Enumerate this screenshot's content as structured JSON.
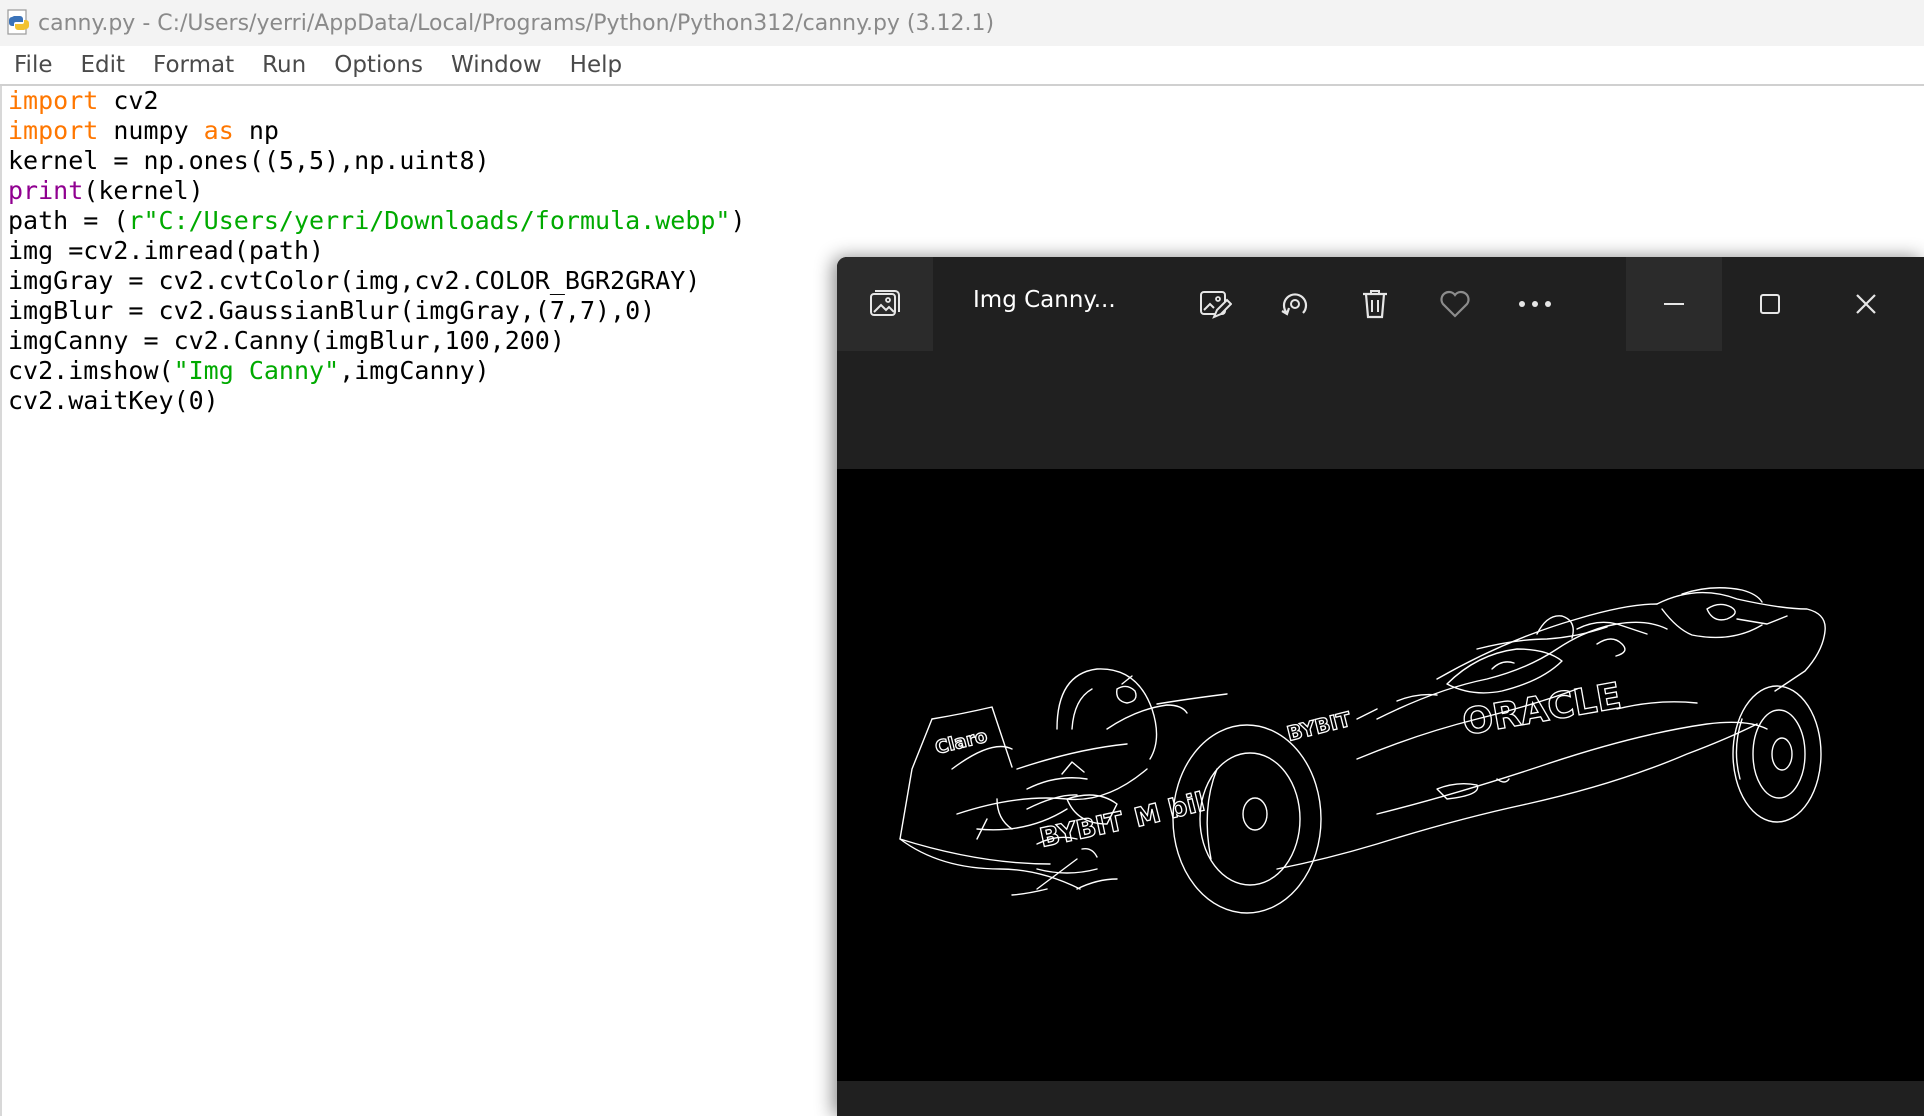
{
  "window": {
    "title": "canny.py - C:/Users/yerri/AppData/Local/Programs/Python/Python312/canny.py (3.12.1)"
  },
  "menu": {
    "items": [
      "File",
      "Edit",
      "Format",
      "Run",
      "Options",
      "Window",
      "Help"
    ]
  },
  "code": {
    "lines": [
      [
        {
          "t": "import",
          "c": "kw"
        },
        {
          "t": " cv2",
          "c": ""
        }
      ],
      [
        {
          "t": "import",
          "c": "kw"
        },
        {
          "t": " numpy ",
          "c": ""
        },
        {
          "t": "as",
          "c": "kw"
        },
        {
          "t": " np",
          "c": ""
        }
      ],
      [
        {
          "t": "kernel = np.ones((5,5),np.uint8)",
          "c": ""
        }
      ],
      [
        {
          "t": "print",
          "c": "bi"
        },
        {
          "t": "(kernel)",
          "c": ""
        }
      ],
      [
        {
          "t": "path = (",
          "c": ""
        },
        {
          "t": "r\"C:/Users/yerri/Downloads/formula.webp\"",
          "c": "str"
        },
        {
          "t": ")",
          "c": ""
        }
      ],
      [
        {
          "t": "img =cv2.imread(path)",
          "c": ""
        }
      ],
      [
        {
          "t": "imgGray = cv2.cvtColor(img,cv2.COLOR_BGR2GRAY)",
          "c": ""
        }
      ],
      [
        {
          "t": "imgBlur = cv2.GaussianBlur(imgGray,(7,7),0)",
          "c": ""
        }
      ],
      [
        {
          "t": "imgCanny = cv2.Canny(imgBlur,100,200)",
          "c": ""
        }
      ],
      [
        {
          "t": "cv2.imshow(",
          "c": ""
        },
        {
          "t": "\"Img Canny\"",
          "c": "str"
        },
        {
          "t": ",imgCanny)",
          "c": ""
        }
      ],
      [
        {
          "t": "cv2.waitKey(0)",
          "c": ""
        }
      ]
    ]
  },
  "viewer": {
    "title": "Img Canny...",
    "toolbar_icons": [
      "edit-image-icon",
      "rotate-icon",
      "delete-icon",
      "favorite-icon",
      "more-icon"
    ],
    "image_texts": {
      "claro": "Claro",
      "bybit_side": "BYBIT",
      "oracle": "ORACLE",
      "bybit_front": "BYBIT",
      "mobil": "bil"
    }
  }
}
